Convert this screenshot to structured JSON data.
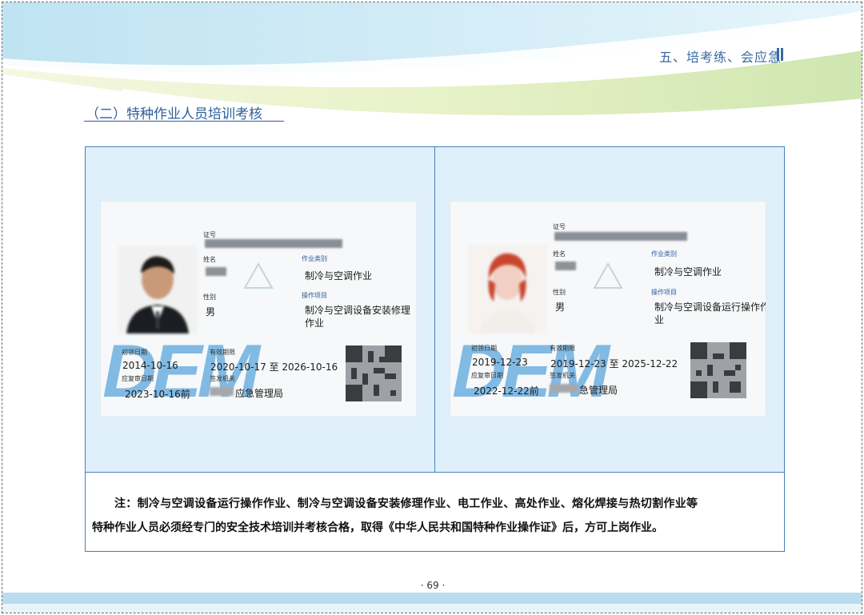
{
  "header": {
    "chapter_title": "五、培考练、会应急"
  },
  "section": {
    "title": "（二）特种作业人员培训考核"
  },
  "cards": [
    {
      "labels": {
        "cert_no": "证号",
        "name": "姓名",
        "gender": "性别",
        "work_category": "作业类别",
        "operation_item": "操作项目",
        "first_issue_date": "初领日期",
        "valid_period": "有效期限",
        "review_date": "应复审日期",
        "issuing_authority": "签发机关"
      },
      "gender": "男",
      "work_category": "制冷与空调作业",
      "operation_item_line1": "制冷与空调设备安装修理",
      "operation_item_line2": "作业",
      "first_issue_date": "2014-10-16",
      "valid_period": "2020-10-17 至 2026-10-16",
      "review_date": "2023-10-16前",
      "issuing_authority": "应急管理局",
      "authority_prefix_partial": "业",
      "watermark": "DEM"
    },
    {
      "labels": {
        "cert_no": "证号",
        "name": "姓名",
        "gender": "性别",
        "work_category": "作业类别",
        "operation_item": "操作项目",
        "first_issue_date": "初领日期",
        "valid_period": "有效期限",
        "review_date": "应复审日期",
        "issuing_authority": "签发机关"
      },
      "gender": "男",
      "work_category": "制冷与空调作业",
      "operation_item_line1": "制冷与空调设备运行操作作",
      "operation_item_line2": "业",
      "first_issue_date": "2019-12-23",
      "valid_period": "2019-12-23 至 2025-12-22",
      "review_date": "2022-12-22前",
      "issuing_authority": "急管理局",
      "watermark": "DEM"
    }
  ],
  "note": {
    "line1": "注：制冷与空调设备运行操作作业、制冷与空调设备安装修理作业、电工作业、高处作业、熔化焊接与热切割作业等",
    "line2": "特种作业人员必须经专门的安全技术培训并考核合格，取得《中华人民共和国特种作业操作证》后，方可上岗作业。"
  },
  "footer": {
    "page_number": "· 69 ·"
  },
  "colors": {
    "accent_blue": "#2e5f9a",
    "table_border": "#4a7fc0",
    "table_fill": "#dff0fb"
  }
}
